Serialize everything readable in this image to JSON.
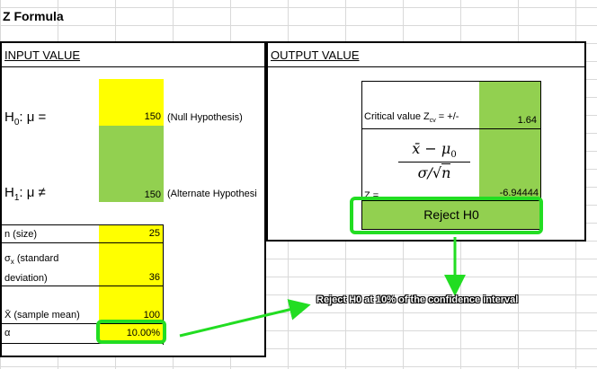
{
  "title": "Z Formula",
  "input": {
    "header": "INPUT VALUE",
    "h0_label": "H",
    "h0_sub": "0",
    "h0_rel": ": μ =",
    "h0_value": "150",
    "h0_note": "(Null Hypothesis)",
    "h1_label": "H",
    "h1_sub": "1",
    "h1_rel": ": μ ≠",
    "h1_value": "150",
    "h1_note": "(Alternate Hypothesi",
    "n_label": "n (size)",
    "n_value": "25",
    "sigma_label_a": "σ",
    "sigma_label_sub": "x",
    "sigma_label_b": " (standard",
    "sigma_label_c": "deviation)",
    "sigma_value": "36",
    "xbar_label": "X̄ (sample mean)",
    "xbar_value": "100",
    "alpha_label": "α",
    "alpha_value": "10.00%"
  },
  "output": {
    "header": "OUTPUT VALUE",
    "critical_label_a": "Critical value Z",
    "critical_label_sub": "cv",
    "critical_label_b": " = +/-",
    "critical_value": "1.64",
    "z_label": "Z =",
    "z_value": "-6.94444",
    "formula_num_a": "x̄",
    "formula_num_op": " − ",
    "formula_num_b": "μ",
    "formula_num_sub": "0",
    "formula_den_a": "σ/",
    "formula_den_root": "√",
    "formula_den_b": "n",
    "result": "Reject H0"
  },
  "annotation": "Reject H0 at 10% of the confidence interval",
  "colors": {
    "yellow": "#ffff00",
    "green": "#92d050",
    "highlight": "#22dd22"
  }
}
